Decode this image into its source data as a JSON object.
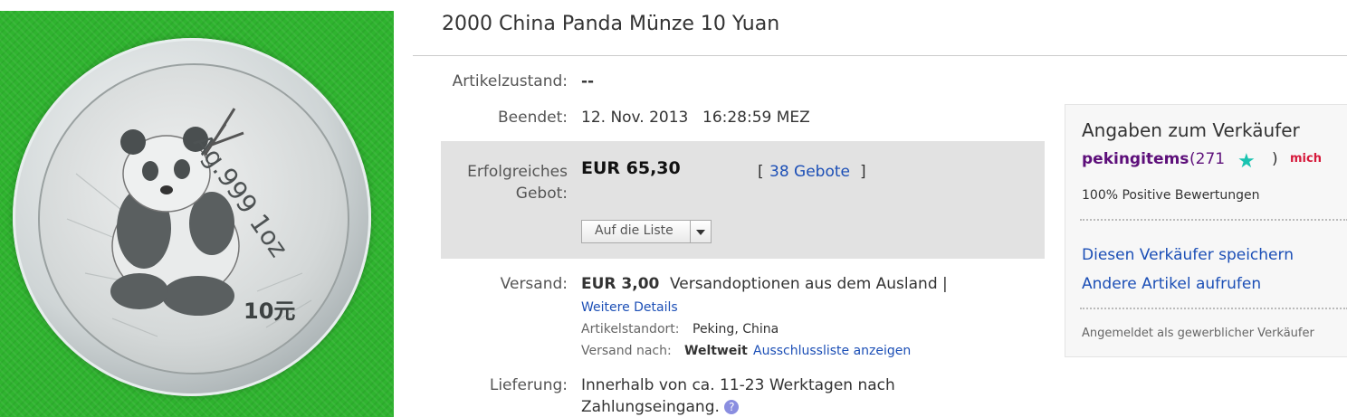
{
  "product_image": {
    "alt": "Silver panda coin"
  },
  "coin": {
    "inscription": "Ag.999 1oz",
    "denomination": "10元"
  },
  "title": "2000 China Panda Münze 10 Yuan",
  "condition": {
    "label": "Artikelzustand:",
    "value": "--"
  },
  "ended": {
    "label": "Beendet:",
    "date": "12. Nov. 2013",
    "time": "16:28:59 MEZ"
  },
  "bid": {
    "label_line1": "Erfolgreiches",
    "label_line2": "Gebot:",
    "price": "EUR 65,30",
    "bids_open": "[",
    "bids_link": "38 Gebote",
    "bids_close": "]",
    "watch_button": "Auf die Liste"
  },
  "shipping": {
    "label": "Versand:",
    "price": "EUR 3,00",
    "options": "Versandoptionen aus dem Ausland |",
    "details_link": "Weitere Details",
    "location_label": "Artikelstandort:",
    "location_value": "Peking, China",
    "ships_to_label": "Versand nach:",
    "ships_to_value": "Weltweit",
    "exclusions_link": "Ausschlussliste anzeigen"
  },
  "delivery": {
    "label": "Lieferung:",
    "line1": "Innerhalb von ca. 11-23 Werktagen nach",
    "line2": "Zahlungseingang.",
    "help_icon": "?"
  },
  "seller": {
    "heading": "Angaben zum Verkäufer",
    "name": "pekingitems",
    "score": "(271",
    "paren_close": ")",
    "me_badge": "mich",
    "positive": "100% Positive Bewertungen",
    "save_link": "Diesen Verkäufer speichern",
    "other_items_link": "Andere Artikel aufrufen",
    "business_note": "Angemeldet als gewerblicher Verkäufer"
  },
  "colors": {
    "link": "#1c4fb6",
    "seller_name": "#5d0f7a",
    "bid_box": "#e2e2e2",
    "background": "#2fb42f"
  }
}
